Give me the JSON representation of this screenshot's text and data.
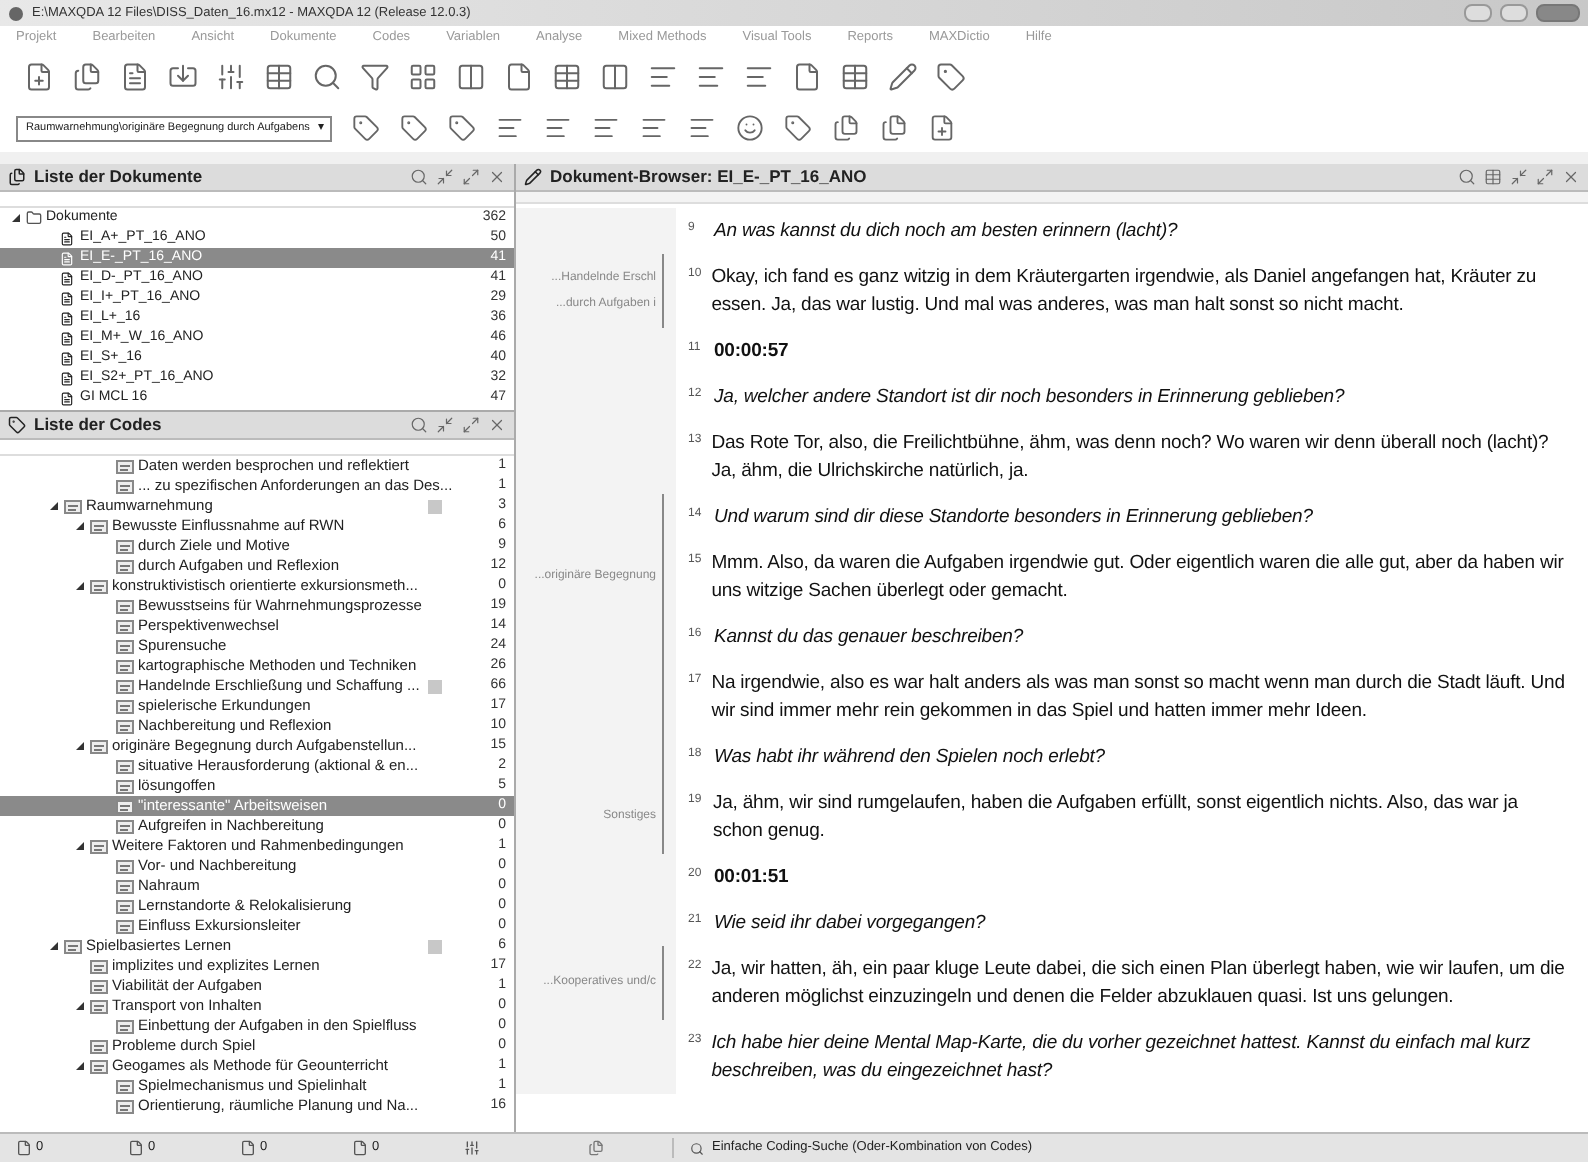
{
  "window": {
    "title": "E:\\MAXQDA 12 Files\\DISS_Daten_16.mx12 - MAXQDA 12  (Release 12.0.3)"
  },
  "menu": [
    "Projekt",
    "Bearbeiten",
    "Ansicht",
    "Dokumente",
    "Codes",
    "Variablen",
    "Analyse",
    "Mixed Methods",
    "Visual Tools",
    "Reports",
    "MAXDictio",
    "Hilfe"
  ],
  "code_dropdown": {
    "value": "Raumwarnehmung\\originäre Begegnung durch Aufgabens",
    "caret": "▾"
  },
  "documents_panel": {
    "title": "Liste der Dokumente",
    "root": {
      "label": "Dokumente",
      "count": "362",
      "expanded": true,
      "children": [
        {
          "label": "EI_A+_PT_16_ANO",
          "count": "50",
          "selected": false
        },
        {
          "label": "EI_E-_PT_16_ANO",
          "count": "41",
          "selected": true
        },
        {
          "label": "EI_D-_PT_16_ANO",
          "count": "41",
          "selected": false
        },
        {
          "label": "EI_I+_PT_16_ANO",
          "count": "29",
          "selected": false
        },
        {
          "label": "EI_L+_16",
          "count": "36",
          "selected": false
        },
        {
          "label": "EI_M+_W_16_ANO",
          "count": "46",
          "selected": false
        },
        {
          "label": "EI_S+_16",
          "count": "40",
          "selected": false
        },
        {
          "label": "EI_S2+_PT_16_ANO",
          "count": "32",
          "selected": false
        },
        {
          "label": "GI MCL 16",
          "count": "47",
          "selected": false
        }
      ]
    }
  },
  "codes_panel": {
    "title": "Liste der Codes",
    "scrolled_rows": [
      {
        "label": "Daten werden besprochen und reflektiert",
        "count": "1"
      },
      {
        "label": "... zu spezifischen Anforderungen an das Des...",
        "count": "1"
      }
    ],
    "items": [
      {
        "label": "Raumwarnehmung",
        "count": "3",
        "marked": true,
        "selected": false,
        "expanded": true,
        "children": [
          {
            "label": "Bewusste Einflussnahme auf RWN",
            "count": "6",
            "selected": false,
            "expanded": true,
            "children": [
              {
                "label": "durch Ziele und Motive",
                "count": "9",
                "selected": false
              },
              {
                "label": "durch Aufgaben und Reflexion",
                "count": "12",
                "selected": false
              }
            ]
          },
          {
            "label": "konstruktivistisch orientierte exkursionsmeth...",
            "count": "0",
            "selected": false,
            "expanded": true,
            "children": [
              {
                "label": "Bewusstseins für Wahrnehmungsprozesse",
                "count": "19",
                "selected": false
              },
              {
                "label": "Perspektivenwechsel",
                "count": "14",
                "selected": false
              },
              {
                "label": "Spurensuche",
                "count": "24",
                "selected": false
              },
              {
                "label": "kartographische Methoden und Techniken",
                "count": "26",
                "selected": false
              },
              {
                "label": "Handelnde Erschließung und Schaffung ...",
                "count": "66",
                "marked": true,
                "selected": false
              },
              {
                "label": "spielerische Erkundungen",
                "count": "17",
                "selected": false
              },
              {
                "label": "Nachbereitung und Reflexion",
                "count": "10",
                "selected": false
              }
            ]
          },
          {
            "label": "originäre Begegnung durch Aufgabenstellun...",
            "count": "15",
            "selected": false,
            "expanded": true,
            "children": [
              {
                "label": "situative Herausforderung (aktional & en...",
                "count": "2",
                "selected": false
              },
              {
                "label": "lösungoffen",
                "count": "5",
                "selected": false
              },
              {
                "label": "\"interessante\" Arbeitsweisen",
                "count": "0",
                "selected": true
              },
              {
                "label": "Aufgreifen in Nachbereitung",
                "count": "0",
                "selected": false
              }
            ]
          },
          {
            "label": "Weitere Faktoren und Rahmenbedingungen",
            "count": "1",
            "selected": false,
            "expanded": true,
            "children": [
              {
                "label": "Vor- und Nachbereitung",
                "count": "0",
                "selected": false
              },
              {
                "label": "Nahraum",
                "count": "0",
                "selected": false
              },
              {
                "label": "Lernstandorte & Relokalisierung",
                "count": "0",
                "selected": false
              },
              {
                "label": "Einfluss Exkursionsleiter",
                "count": "0",
                "selected": false
              }
            ]
          }
        ]
      },
      {
        "label": "Spielbasiertes Lernen",
        "count": "6",
        "marked": true,
        "selected": false,
        "expanded": true,
        "children": [
          {
            "label": "implizites und explizites Lernen",
            "count": "17",
            "selected": false
          },
          {
            "label": "Viabilität der Aufgaben",
            "count": "1",
            "selected": false
          },
          {
            "label": "Transport von Inhalten",
            "count": "0",
            "selected": false,
            "expanded": true,
            "children": [
              {
                "label": "Einbettung der Aufgaben in den Spielfluss",
                "count": "0",
                "selected": false
              }
            ]
          },
          {
            "label": "Probleme durch Spiel",
            "count": "0",
            "selected": false
          },
          {
            "label": "Geogames als Methode für Geounterricht",
            "count": "1",
            "selected": false,
            "expanded": true,
            "children": [
              {
                "label": "Spielmechanismus und Spielinhalt",
                "count": "1",
                "selected": false
              },
              {
                "label": "Orientierung, räumliche Planung und Na...",
                "count": "16",
                "selected": false
              }
            ]
          }
        ]
      }
    ]
  },
  "status_counts": [
    "0",
    "0",
    "0",
    "0"
  ],
  "document_browser": {
    "title": "Dokument-Browser: EI_E-_PT_16_ANO",
    "paragraphs": [
      {
        "number": "9",
        "kind": "question",
        "text": "An was kannst du dich noch am besten erinnern (lacht)?",
        "bracket": false
      },
      {
        "number": "10",
        "kind": "answer",
        "text": "Okay, ich fand es ganz witzig in dem Kräutergarten irgendwie, als Daniel angefangen hat, Kräuter zu essen. Ja, das war lustig. Und mal was anderes, was man halt sonst so nicht macht.",
        "bracket": true,
        "codes": [
          "...Handelnde Erschl",
          "...durch Aufgaben i"
        ]
      },
      {
        "number": "11",
        "kind": "timestamp",
        "text": "00:00:57",
        "bracket": false
      },
      {
        "number": "12",
        "kind": "question",
        "text": "Ja, welcher andere Standort ist dir noch besonders in Erinnerung geblieben?",
        "bracket": false
      },
      {
        "number": "13",
        "kind": "answer",
        "text": "Das Rote Tor, also, die Freilichtbühne, ähm, was denn noch? Wo waren wir denn überall noch (lacht)? Ja, ähm, die Ulrichskirche natürlich, ja.",
        "bracket": false
      },
      {
        "number": "14",
        "kind": "question",
        "text": "Und warum sind dir diese Standorte besonders in Erinnerung geblieben?",
        "bracket": true
      },
      {
        "number": "15",
        "kind": "answer",
        "text": "Mmm. Also, da waren die Aufgaben irgendwie gut. Oder eigentlich waren die alle gut, aber da haben wir uns witzige Sachen überlegt oder gemacht.",
        "bracket": true,
        "codes": [
          "...originäre Begegnung"
        ]
      },
      {
        "number": "16",
        "kind": "question",
        "text": "Kannst du das genauer beschreiben?",
        "bracket": true
      },
      {
        "number": "17",
        "kind": "answer",
        "text": "Na irgendwie, also es war halt anders als was man sonst so macht wenn man durch die Stadt läuft. Und wir sind immer mehr rein gekommen in das Spiel und hatten immer mehr Ideen.",
        "bracket": true
      },
      {
        "number": "18",
        "kind": "question",
        "text": "Was habt ihr während den Spielen noch erlebt?",
        "bracket": true
      },
      {
        "number": "19",
        "kind": "answer",
        "text": "Ja, ähm, wir sind rumgelaufen, haben die Aufgaben erfüllt, sonst eigentlich nichts. Also, das war ja schon genug.",
        "bracket": true,
        "codes": [
          "Sonstiges"
        ]
      },
      {
        "number": "20",
        "kind": "timestamp",
        "text": "00:01:51",
        "bracket": false
      },
      {
        "number": "21",
        "kind": "question",
        "text": "Wie seid ihr dabei vorgegangen?",
        "bracket": false
      },
      {
        "number": "22",
        "kind": "answer",
        "text": "Ja, wir hatten, äh, ein paar kluge Leute dabei, die sich einen Plan überlegt haben, wie wir laufen, um die anderen möglichst einzuzingeln und denen die Felder abzuklauen quasi. Ist uns gelungen.",
        "bracket": true,
        "codes": [
          "...Kooperatives und/c"
        ]
      },
      {
        "number": "23",
        "kind": "question",
        "text": "Ich habe hier deine Mental Map-Karte, die du vorher gezeichnet hattest. Kannst du einfach mal kurz beschreiben, was du eingezeichnet hast?",
        "bracket": false
      }
    ]
  },
  "status_search": "Einfache Coding-Suche (Oder-Kombination von Codes)"
}
